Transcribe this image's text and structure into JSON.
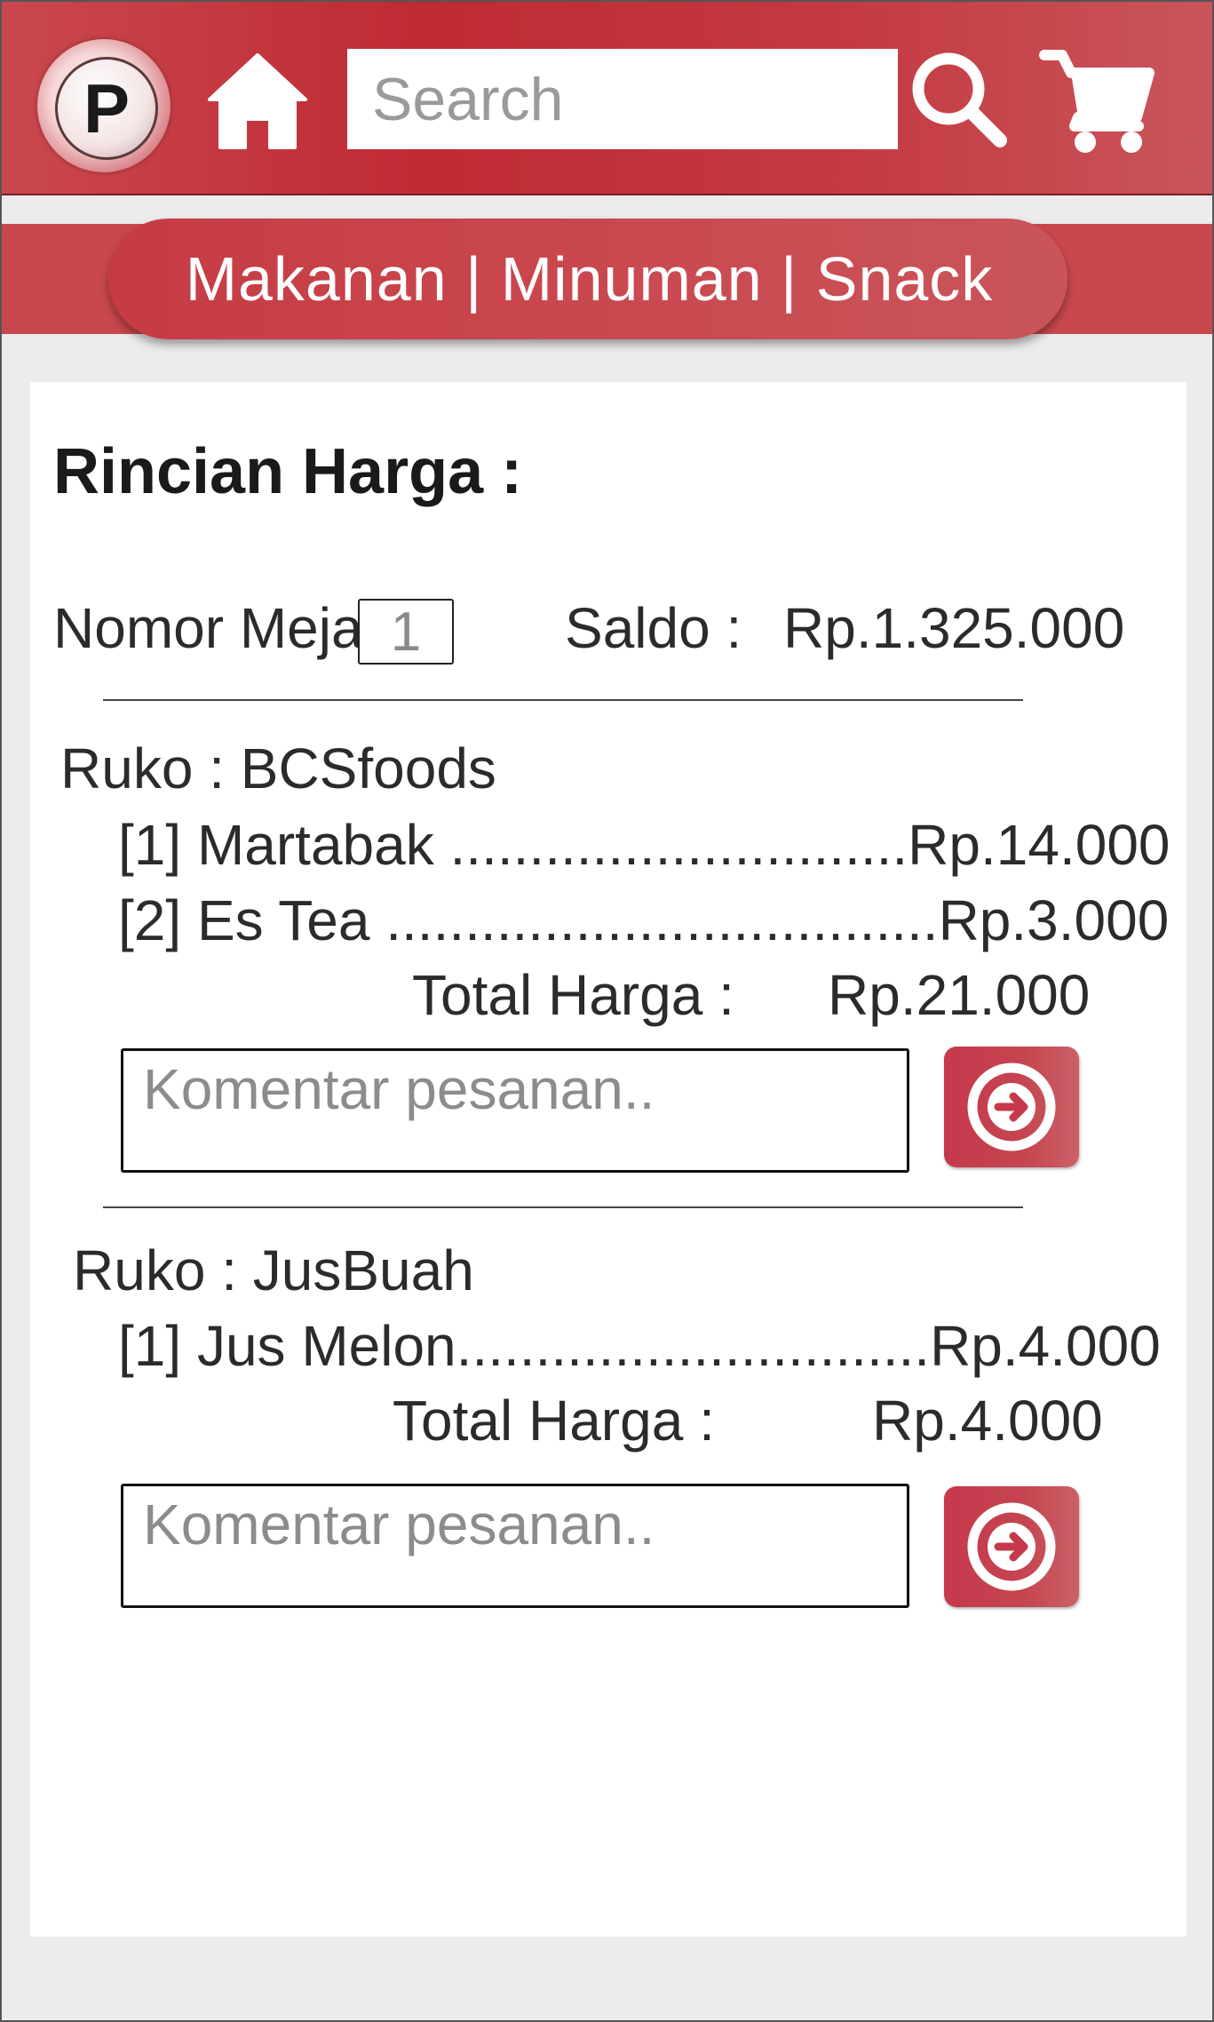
{
  "header": {
    "logo_letter": "P",
    "search_placeholder": "Search"
  },
  "categories": {
    "food": "Makanan",
    "drink": "Minuman",
    "snack": "Snack",
    "separator": " | "
  },
  "details": {
    "title": "Rincian Harga :",
    "table_label": "Nomor Meja",
    "table_number": "1",
    "balance_label": "Saldo :",
    "balance_value": "Rp.1.325.000"
  },
  "stores": [
    {
      "store_label": "Ruko : BCSfoods",
      "items": [
        "[1] Martabak .............................Rp.14.000",
        "[2] Es Tea ...................................Rp.3.000"
      ],
      "total_label": "Total Harga :",
      "total_value": "Rp.21.000",
      "comment_placeholder": "Komentar pesanan.."
    },
    {
      "store_label": "Ruko : JusBuah",
      "items": [
        "[1] Jus Melon..............................Rp.4.000"
      ],
      "total_label": "Total Harga :",
      "total_value": "Rp.4.000",
      "comment_placeholder": "Komentar pesanan.."
    }
  ],
  "colors": {
    "primary_red": "#c9484e",
    "dark_red": "#bf2a33"
  },
  "icons": [
    "app-logo-icon",
    "home-icon",
    "search-icon",
    "cart-icon",
    "arrow-right-circle-icon"
  ]
}
